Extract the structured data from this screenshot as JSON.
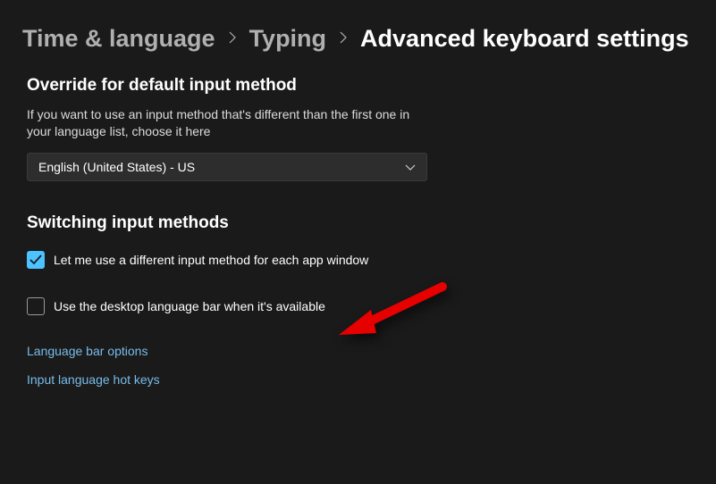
{
  "breadcrumb": {
    "level1": "Time & language",
    "level2": "Typing",
    "current": "Advanced keyboard settings"
  },
  "override": {
    "header": "Override for default input method",
    "desc": "If you want to use an input method that's different than the first one in your language list, choose it here",
    "selected": "English (United States) - US"
  },
  "switching": {
    "header": "Switching input methods",
    "checkbox1": {
      "label": "Let me use a different input method for each app window",
      "checked": true
    },
    "checkbox2": {
      "label": "Use the desktop language bar when it's available",
      "checked": false
    }
  },
  "links": {
    "langbar": "Language bar options",
    "hotkeys": "Input language hot keys"
  }
}
